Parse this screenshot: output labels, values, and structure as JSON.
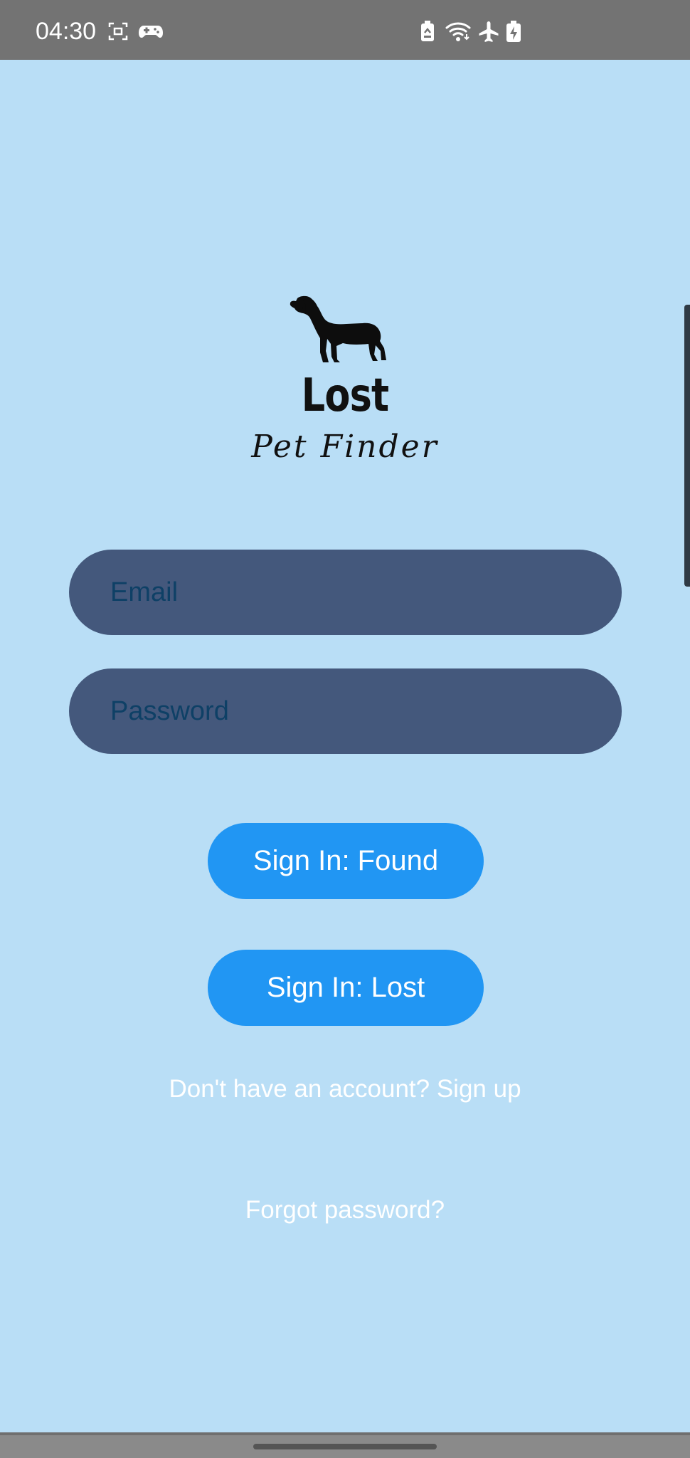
{
  "status_bar": {
    "time": "04:30",
    "icons": [
      "screenshot-icon",
      "gamepad-icon",
      "battery-saver-icon",
      "wifi-icon",
      "airplane-icon",
      "battery-charging-icon"
    ]
  },
  "logo": {
    "title": "Lost",
    "subtitle": "Pet Finder",
    "icon": "dog-icon"
  },
  "form": {
    "email_placeholder": "Email",
    "email_value": "",
    "password_placeholder": "Password",
    "password_value": ""
  },
  "buttons": {
    "sign_in_found": "Sign In: Found",
    "sign_in_lost": "Sign In: Lost"
  },
  "links": {
    "signup": "Don't have an account? Sign up",
    "forgot_password": "Forgot password?"
  },
  "colors": {
    "background": "#b9def6",
    "field": "#44587c",
    "button": "#2196f3",
    "status_bar": "#737373"
  }
}
